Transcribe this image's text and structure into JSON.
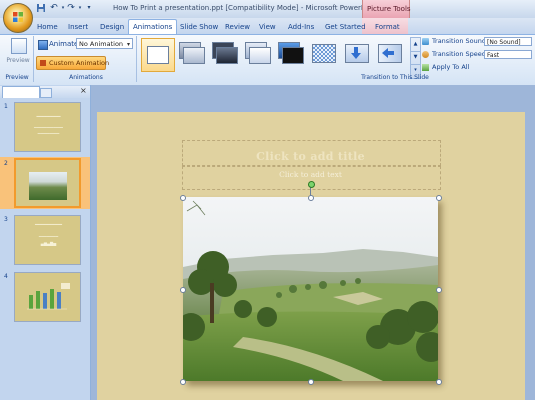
{
  "window": {
    "title": "How To Print a presentation.ppt [Compatibility Mode] - Microsoft PowerPoint",
    "context_tab_group": "Picture Tools"
  },
  "quick_access": [
    "save-icon",
    "undo-icon",
    "redo-icon",
    "customize-icon"
  ],
  "tabs": [
    {
      "label": "Home",
      "active": false
    },
    {
      "label": "Insert",
      "active": false
    },
    {
      "label": "Design",
      "active": false
    },
    {
      "label": "Animations",
      "active": true
    },
    {
      "label": "Slide Show",
      "active": false
    },
    {
      "label": "Review",
      "active": false
    },
    {
      "label": "View",
      "active": false
    },
    {
      "label": "Add-Ins",
      "active": false
    },
    {
      "label": "Get Started",
      "active": false
    },
    {
      "label": "Format",
      "active": false
    }
  ],
  "ribbon": {
    "preview": {
      "button_label": "Preview",
      "group_label": "Preview"
    },
    "animations": {
      "animate_label": "Animate:",
      "animate_value": "No Animation",
      "custom_button": "Custom Animation",
      "group_label": "Animations"
    },
    "transition": {
      "group_label": "Transition to This Slide",
      "sound_label": "Transition Sound:",
      "sound_value": "[No Sound]",
      "speed_label": "Transition Speed:",
      "speed_value": "Fast",
      "apply_all": "Apply To All"
    }
  },
  "slides_pane": {
    "slides": [
      {
        "number": "1",
        "selected": false
      },
      {
        "number": "2",
        "selected": true
      },
      {
        "number": "3",
        "selected": false
      },
      {
        "number": "4",
        "selected": false
      }
    ]
  },
  "slide": {
    "title_placeholder": "Click to add title",
    "text_placeholder": "Click to add text"
  },
  "colors": {
    "slide_background": "#e0d2a0",
    "accent_orange": "#f29a2c",
    "ribbon_blue": "#15428b",
    "picture_tools_pink": "#eaa4b3"
  }
}
